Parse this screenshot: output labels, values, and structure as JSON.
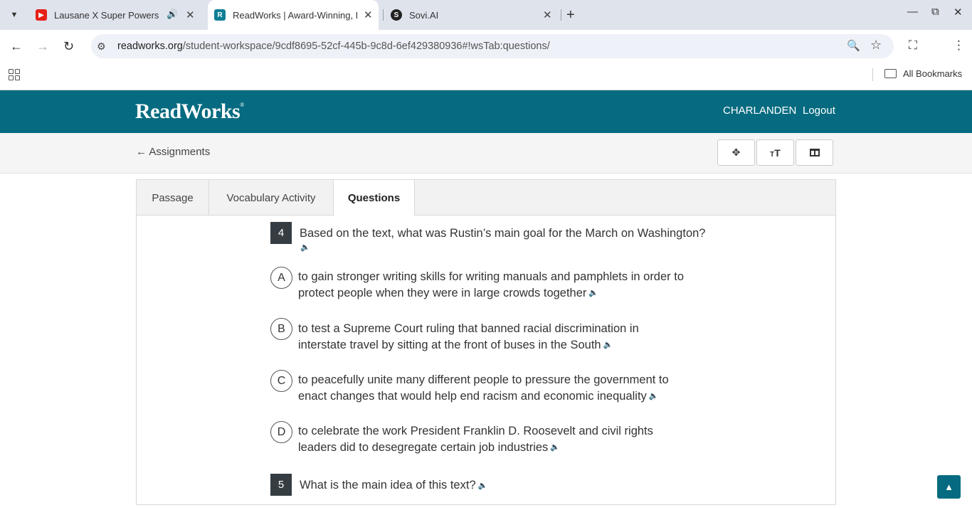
{
  "browser": {
    "tabs": [
      {
        "title": "Lausane X Super Powers - C",
        "favicon": "youtube-icon"
      },
      {
        "title": "ReadWorks | Award-Winning, Ed",
        "favicon": "readworks-icon"
      },
      {
        "title": "Sovi.AI",
        "favicon": "sovi-icon"
      }
    ],
    "url_host": "readworks.org",
    "url_path": "/student-workspace/9cdf8695-52cf-445b-9c8d-6ef429380936#!wsTab:questions/",
    "bookmarks_label": "All Bookmarks"
  },
  "header": {
    "logo": "ReadWorks",
    "logo_mark": "®",
    "username": "CHARLANDEN",
    "logout": "Logout"
  },
  "subbar": {
    "back_label": "← Assignments"
  },
  "content_tabs": [
    "Passage",
    "Vocabulary Activity",
    "Questions"
  ],
  "questions": [
    {
      "number": "4",
      "text": "Based on the text, what was Rustin’s main goal for the March on Washington?",
      "options": [
        {
          "letter": "A",
          "line1": "to gain stronger writing skills for writing manuals and pamphlets in order to",
          "line2": "protect people when they were in large crowds together"
        },
        {
          "letter": "B",
          "line1": "to test a Supreme Court ruling that banned racial discrimination in",
          "line2": "interstate travel by sitting at the front of buses in the South"
        },
        {
          "letter": "C",
          "line1": "to peacefully unite many different people to pressure the government to",
          "line2": "enact changes that would help end racism and economic inequality"
        },
        {
          "letter": "D",
          "line1": "to celebrate the work President Franklin D. Roosevelt and civil rights",
          "line2": "leaders did to desegregate certain job industries"
        }
      ]
    },
    {
      "number": "5",
      "text": "What is the main idea of this text?"
    }
  ],
  "colors": {
    "brand": "#066b80",
    "question_badge": "#353d43"
  }
}
